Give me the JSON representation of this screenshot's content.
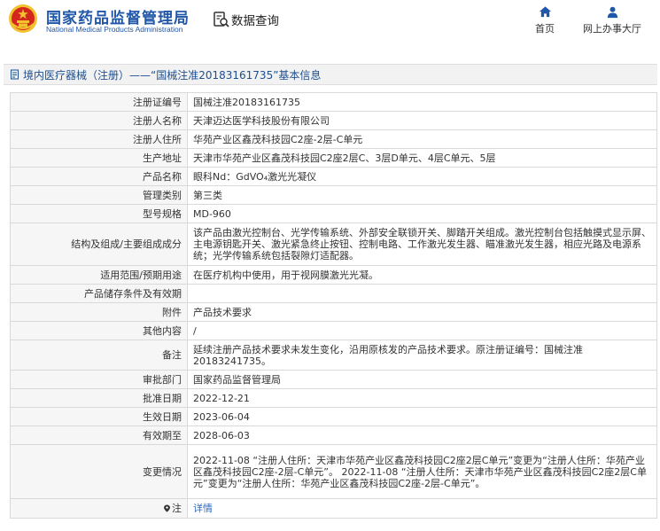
{
  "header": {
    "logo_cn": "国家药品监督管理局",
    "logo_en": "National Medical Products Administration",
    "data_search": "数据查询",
    "nav": {
      "home": "首页",
      "office": "网上办事大厅"
    }
  },
  "titlebar": {
    "text": "境内医疗器械（注册）——“国械注准20183161735”基本信息"
  },
  "rows": [
    {
      "label": "注册证编号",
      "value": "国械注准20183161735"
    },
    {
      "label": "注册人名称",
      "value": "天津迈达医学科技股份有限公司"
    },
    {
      "label": "注册人住所",
      "value": "华苑产业区鑫茂科技园C2座-2层-C单元"
    },
    {
      "label": "生产地址",
      "value": "天津市华苑产业区鑫茂科技园C2座2层C、3层D单元、4层C单元、5层"
    },
    {
      "label": "产品名称",
      "value": "眼科Nd：GdVO₄激光光凝仪"
    },
    {
      "label": "管理类别",
      "value": "第三类"
    },
    {
      "label": "型号规格",
      "value": "MD-960"
    },
    {
      "label": "结构及组成/主要组成成分",
      "value": "该产品由激光控制台、光学传输系统、外部安全联锁开关、脚踏开关组成。激光控制台包括触摸式显示屏、主电源钥匙开关、激光紧急终止按钮、控制电路、工作激光发生器、瞄准激光发生器，相应光路及电源系统；光学传输系统包括裂隙灯适配器。"
    },
    {
      "label": "适用范围/预期用途",
      "value": "在医疗机构中使用，用于视网膜激光光凝。"
    },
    {
      "label": "产品储存条件及有效期",
      "value": ""
    },
    {
      "label": "附件",
      "value": "产品技术要求"
    },
    {
      "label": "其他内容",
      "value": "/"
    },
    {
      "label": "备注",
      "value": "延续注册产品技术要求未发生变化，沿用原核发的产品技术要求。原注册证编号：国械注准20183241735。"
    },
    {
      "label": "审批部门",
      "value": "国家药品监督管理局"
    },
    {
      "label": "批准日期",
      "value": "2022-12-21"
    },
    {
      "label": "生效日期",
      "value": "2023-06-04"
    },
    {
      "label": "有效期至",
      "value": "2028-06-03"
    },
    {
      "label": "变更情况",
      "value": "2022-11-08 “注册人住所：天津市华苑产业区鑫茂科技园C2座2层C单元”变更为“注册人住所：华苑产业区鑫茂科技园C2座-2层-C单元”。 2022-11-08 “注册人住所：天津市华苑产业区鑫茂科技园C2座2层C单元”变更为“注册人住所：华苑产业区鑫茂科技园C2座-2层-C单元”。"
    },
    {
      "label": "注",
      "value": "详情"
    }
  ],
  "colors": {
    "brand_blue": "#2157a8",
    "emblem_red": "#d3261c",
    "emblem_gold": "#f2c12e",
    "link_blue": "#2a6bc2"
  },
  "icons": {
    "logo": "national-emblem-icon",
    "data_search": "magnifier-document-icon",
    "home": "home-icon",
    "office": "user-icon",
    "title": "document-icon",
    "note": "location-pin-icon"
  }
}
